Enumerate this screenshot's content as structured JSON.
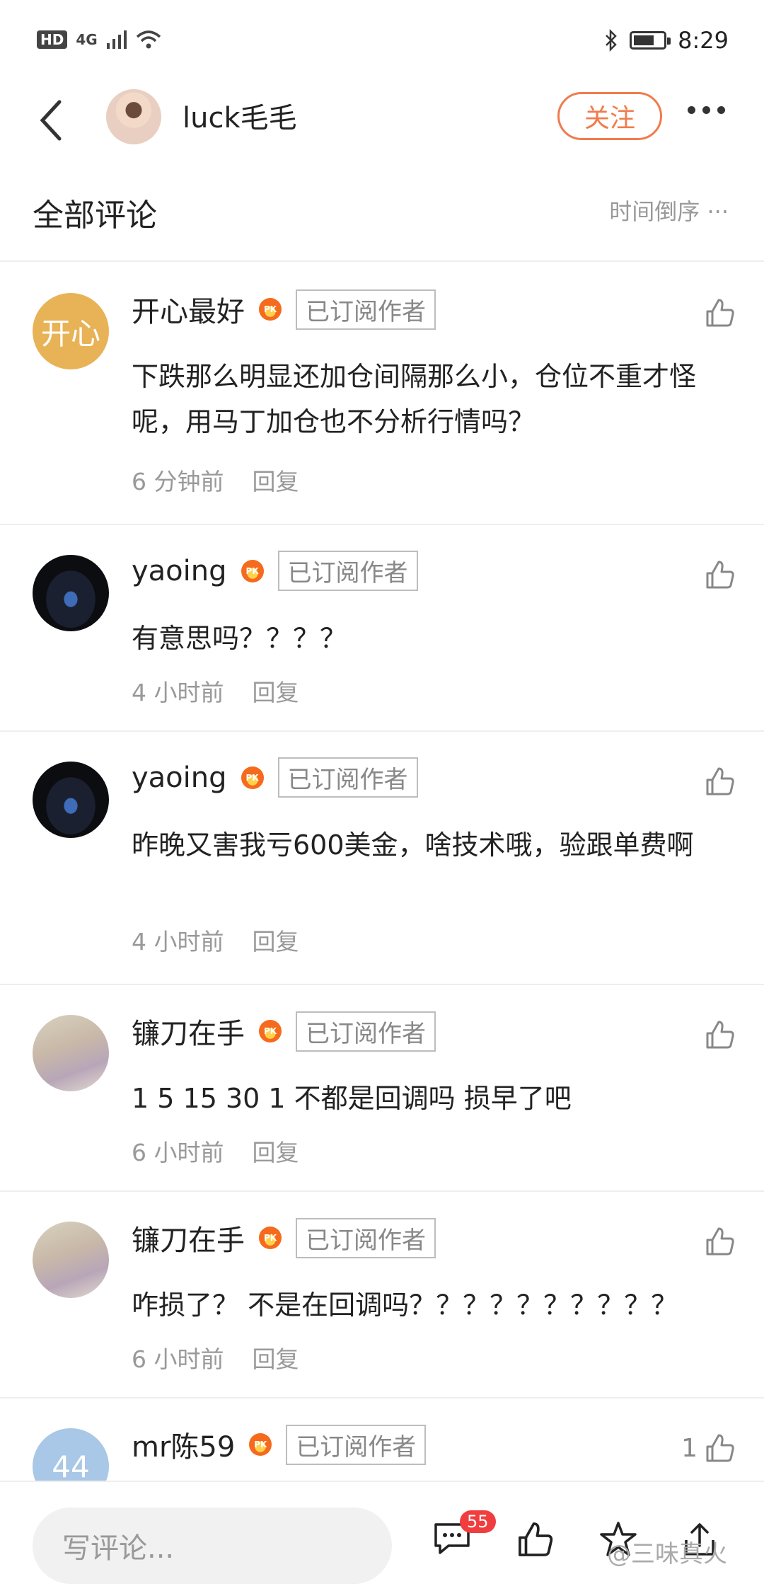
{
  "status_bar": {
    "hd": "HD",
    "network": "4G",
    "time": "8:29"
  },
  "header": {
    "author_name": "luck毛毛",
    "follow_label": "关注"
  },
  "comments_header": {
    "title": "全部评论",
    "sort_label": "时间倒序",
    "sort_more": "···"
  },
  "subscriber_tag": "已订阅作者",
  "reply_label": "回复",
  "comments": [
    {
      "avatar_text": "开心",
      "user": "开心最好",
      "text": "下跌那么明显还加仓间隔那么小，仓位不重才怪呢，用马丁加仓也不分析行情吗？",
      "time": "6 分钟前",
      "likes": ""
    },
    {
      "avatar_text": "",
      "user": "yaoing",
      "text": "有意思吗？？？？",
      "time": "4 小时前",
      "likes": ""
    },
    {
      "avatar_text": "",
      "user": "yaoing",
      "text": "昨晚又害我亏600美金，啥技术哦，验跟单费啊",
      "time": "4 小时前",
      "likes": ""
    },
    {
      "avatar_text": "",
      "user": "镰刀在手",
      "text": "1 5 15 30 1 不都是回调吗 损早了吧",
      "time": "6 小时前",
      "likes": ""
    },
    {
      "avatar_text": "",
      "user": "镰刀在手",
      "text": "咋损了？ 不是在回调吗？？？？？？？？？？",
      "time": "6 小时前",
      "likes": ""
    },
    {
      "avatar_text": "44",
      "user": "mr陈59",
      "text": "",
      "time": "",
      "likes": "1"
    }
  ],
  "bottom_bar": {
    "input_placeholder": "写评论...",
    "comment_count": "55",
    "watermark": "@三味真火"
  }
}
